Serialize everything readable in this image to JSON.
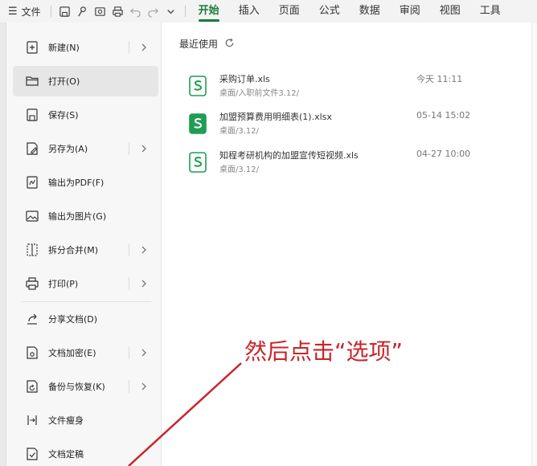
{
  "toolbar": {
    "file_menu_label": "文件",
    "tabs": [
      {
        "label": "开始",
        "active": true
      },
      {
        "label": "插入"
      },
      {
        "label": "页面"
      },
      {
        "label": "公式"
      },
      {
        "label": "数据"
      },
      {
        "label": "审阅"
      },
      {
        "label": "视图"
      },
      {
        "label": "工具"
      }
    ],
    "quick_icons": [
      "save-icon",
      "brush-icon",
      "print-preview-icon",
      "print-icon",
      "undo-icon",
      "redo-icon",
      "chevron-down-icon"
    ],
    "accent_color": "#1b7b3b"
  },
  "menu": {
    "items": [
      {
        "label": "新建(N)",
        "icon": "new-file-icon",
        "has_submenu": true
      },
      {
        "label": "打开(O)",
        "icon": "folder-open-icon",
        "has_submenu": false,
        "selected": true
      },
      {
        "label": "保存(S)",
        "icon": "save-icon",
        "has_submenu": false
      },
      {
        "label": "另存为(A)",
        "icon": "save-as-icon",
        "has_submenu": true
      },
      {
        "label": "输出为PDF(F)",
        "icon": "export-pdf-icon",
        "has_submenu": false
      },
      {
        "label": "输出为图片(G)",
        "icon": "export-image-icon",
        "has_submenu": false
      },
      {
        "label": "拆分合并(M)",
        "icon": "split-merge-icon",
        "has_submenu": true
      },
      {
        "label": "打印(P)",
        "icon": "print-icon",
        "has_submenu": true
      },
      {
        "label": "分享文档(D)",
        "icon": "share-icon",
        "has_submenu": false
      },
      {
        "label": "文档加密(E)",
        "icon": "encrypt-icon",
        "has_submenu": true
      },
      {
        "label": "备份与恢复(K)",
        "icon": "backup-icon",
        "has_submenu": true
      },
      {
        "label": "文件瘦身",
        "icon": "slim-file-icon",
        "has_submenu": false
      },
      {
        "label": "文档定稿",
        "icon": "finalize-icon",
        "has_submenu": false
      }
    ]
  },
  "recent": {
    "title": "最近使用",
    "refresh_icon": "refresh-icon",
    "files": [
      {
        "name": "采购订单.xls",
        "path": "桌面/入职前文件3.12/",
        "time": "今天 11:11",
        "icon_style": "outline"
      },
      {
        "name": "加盟预算费用明细表(1).xlsx",
        "path": "桌面/3.12/",
        "time": "05-14 15:02",
        "icon_style": "filled"
      },
      {
        "name": "知程考研机构的加盟宣传短视频.xls",
        "path": "桌面/3.12/",
        "time": "04-27 10:00",
        "icon_style": "outline"
      }
    ]
  },
  "annotation": {
    "text": "然后点击“选项”",
    "color": "#c8252a"
  }
}
